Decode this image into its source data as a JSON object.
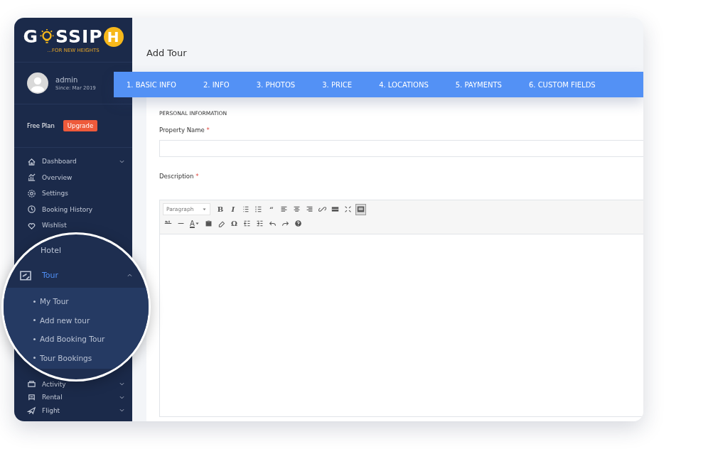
{
  "logo": {
    "letters_before": "G",
    "letters_after": "SSIP",
    "badge": "H",
    "tagline": "...FOR NEW HEIGHTS"
  },
  "user": {
    "name": "admin",
    "since": "Since: Mar 2019"
  },
  "plan": {
    "label": "Free Plan",
    "button": "Upgrade"
  },
  "sidebar": {
    "items": [
      {
        "label": "Dashboard",
        "has_caret": true
      },
      {
        "label": "Overview",
        "has_caret": false
      },
      {
        "label": "Settings",
        "has_caret": false
      },
      {
        "label": "Booking History",
        "has_caret": false
      },
      {
        "label": "Wishlist",
        "has_caret": false
      }
    ],
    "lower_items": [
      {
        "label": "Activity",
        "has_caret": true
      },
      {
        "label": "Rental",
        "has_caret": true
      },
      {
        "label": "Flight",
        "has_caret": true
      }
    ]
  },
  "magnifier": {
    "above": "Hotel",
    "menu": {
      "label": "Tour",
      "selected": true,
      "expanded": true,
      "children": [
        {
          "label": "My Tour"
        },
        {
          "label": "Add new tour"
        },
        {
          "label": "Add Booking Tour"
        },
        {
          "label": "Tour Bookings"
        }
      ]
    }
  },
  "page_title": "Add Tour",
  "tabs": [
    {
      "label": "1. BASIC INFO"
    },
    {
      "label": "2. INFO"
    },
    {
      "label": "3. PHOTOS"
    },
    {
      "label": "3. PRICE"
    },
    {
      "label": "4. LOCATIONS"
    },
    {
      "label": "5. PAYMENTS"
    },
    {
      "label": "6. CUSTOM FIELDS"
    }
  ],
  "form": {
    "section": "PERSONAL INFORMATION",
    "fields": [
      {
        "kind": "input",
        "label": "Property Name",
        "required": "*"
      },
      {
        "kind": "editor",
        "label": "Description",
        "required": "*"
      }
    ],
    "editor": {
      "format": "Paragraph",
      "toolbar": [
        [
          {
            "kind": "text",
            "label": "B",
            "pressed": false
          },
          {
            "kind": "text",
            "label": "I",
            "pressed": false
          },
          {
            "kind": "icon",
            "pressed": false
          },
          {
            "kind": "icon",
            "pressed": false
          },
          {
            "kind": "text",
            "label": "“",
            "pressed": false
          },
          {
            "kind": "icon",
            "pressed": false
          },
          {
            "kind": "icon",
            "pressed": false
          },
          {
            "kind": "icon",
            "pressed": false
          },
          {
            "kind": "icon",
            "pressed": false
          },
          {
            "kind": "icon",
            "pressed": false
          },
          {
            "kind": "icon",
            "pressed": false
          },
          {
            "kind": "icon",
            "pressed": true
          }
        ],
        [
          {
            "kind": "icon",
            "pressed": false
          },
          {
            "kind": "icon",
            "pressed": false
          },
          {
            "kind": "color",
            "label": "A",
            "pressed": false
          },
          {
            "kind": "icon",
            "pressed": false
          },
          {
            "kind": "icon",
            "pressed": false
          },
          {
            "kind": "text",
            "label": "Ω",
            "pressed": false
          },
          {
            "kind": "icon",
            "pressed": false
          },
          {
            "kind": "icon",
            "pressed": false
          },
          {
            "kind": "icon",
            "pressed": false
          },
          {
            "kind": "icon",
            "pressed": false
          },
          {
            "kind": "icon",
            "pressed": false
          }
        ]
      ]
    }
  }
}
